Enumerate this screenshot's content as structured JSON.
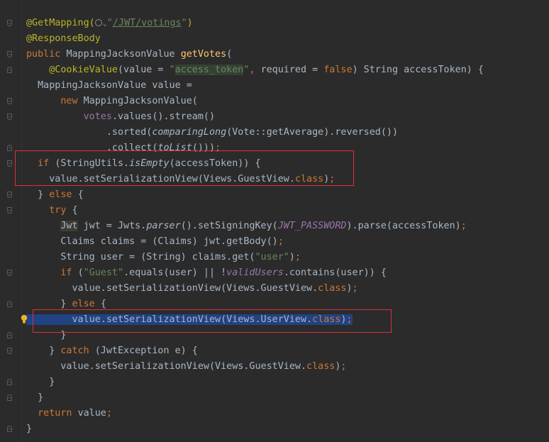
{
  "editor": {
    "lines": [
      {
        "segments": [
          {
            "t": "@GetMapping(",
            "c": "ann"
          },
          {
            "t": "globe",
            "c": "globe"
          },
          {
            "t": "⌄",
            "c": "chev"
          },
          {
            "t": "\"",
            "c": "str"
          },
          {
            "t": "/JWT/votings",
            "c": "url"
          },
          {
            "t": "\"",
            "c": "str"
          },
          {
            "t": ")",
            "c": "ann"
          }
        ]
      },
      {
        "segments": [
          {
            "t": "@ResponseBody",
            "c": "ann"
          }
        ]
      },
      {
        "segments": [
          {
            "t": "public ",
            "c": "kw"
          },
          {
            "t": "MappingJacksonValue ",
            "c": ""
          },
          {
            "t": "getVotes",
            "c": "fn"
          },
          {
            "t": "(",
            "c": ""
          }
        ]
      },
      {
        "segments": [
          {
            "t": "    ",
            "c": ""
          },
          {
            "t": "@CookieValue",
            "c": "ann"
          },
          {
            "t": "(value = ",
            "c": ""
          },
          {
            "t": "\"",
            "c": "str"
          },
          {
            "t": "access_token",
            "c": "strbg"
          },
          {
            "t": "\"",
            "c": "str"
          },
          {
            "t": ", ",
            "c": "kw"
          },
          {
            "t": "required = ",
            "c": ""
          },
          {
            "t": "false",
            "c": "kw"
          },
          {
            "t": ") String accessToken) {",
            "c": ""
          }
        ]
      },
      {
        "segments": [
          {
            "t": "  MappingJacksonValue value =",
            "c": ""
          }
        ]
      },
      {
        "segments": [
          {
            "t": "      ",
            "c": ""
          },
          {
            "t": "new ",
            "c": "kw"
          },
          {
            "t": "MappingJacksonValue(",
            "c": ""
          }
        ]
      },
      {
        "segments": [
          {
            "t": "          ",
            "c": ""
          },
          {
            "t": "votes",
            "c": "fld2"
          },
          {
            "t": ".values().stream()",
            "c": ""
          }
        ]
      },
      {
        "segments": [
          {
            "t": "              .sorted(",
            "c": ""
          },
          {
            "t": "comparingLong",
            "c": "st"
          },
          {
            "t": "(Vote::getAverage).reversed())",
            "c": ""
          }
        ]
      },
      {
        "segments": [
          {
            "t": "              .collect(",
            "c": ""
          },
          {
            "t": "toList",
            "c": "st"
          },
          {
            "t": "()))",
            "c": ""
          },
          {
            "t": ";",
            "c": "semi"
          }
        ]
      },
      {
        "segments": [
          {
            "t": "  ",
            "c": ""
          },
          {
            "t": "if ",
            "c": "kw"
          },
          {
            "t": "(StringUtils.",
            "c": ""
          },
          {
            "t": "isEmpty",
            "c": "st"
          },
          {
            "t": "(accessToken)) {",
            "c": ""
          }
        ]
      },
      {
        "segments": [
          {
            "t": "    value.setSerializationView(Views.GuestView.",
            "c": ""
          },
          {
            "t": "class",
            "c": "kw"
          },
          {
            "t": ")",
            "c": ""
          },
          {
            "t": ";",
            "c": "semi"
          }
        ]
      },
      {
        "segments": [
          {
            "t": "  } ",
            "c": ""
          },
          {
            "t": "else ",
            "c": "kw"
          },
          {
            "t": "{",
            "c": ""
          }
        ]
      },
      {
        "segments": [
          {
            "t": "    ",
            "c": ""
          },
          {
            "t": "try ",
            "c": "kw"
          },
          {
            "t": "{",
            "c": ""
          }
        ]
      },
      {
        "segments": [
          {
            "t": "      ",
            "c": ""
          },
          {
            "t": "Jwt",
            "c": "jwtbg"
          },
          {
            "t": " jwt = Jwts.",
            "c": ""
          },
          {
            "t": "parser",
            "c": "st"
          },
          {
            "t": "().setSigningKey(",
            "c": ""
          },
          {
            "t": "JWT_PASSWORD",
            "c": "fld"
          },
          {
            "t": ").parse(accessToken)",
            "c": ""
          },
          {
            "t": ";",
            "c": "semi"
          }
        ]
      },
      {
        "segments": [
          {
            "t": "      Claims claims = (Claims) jwt.getBody()",
            "c": ""
          },
          {
            "t": ";",
            "c": "semi"
          }
        ]
      },
      {
        "segments": [
          {
            "t": "      String user = (String) claims.get(",
            "c": ""
          },
          {
            "t": "\"user\"",
            "c": "str"
          },
          {
            "t": ")",
            "c": ""
          },
          {
            "t": ";",
            "c": "semi"
          }
        ]
      },
      {
        "segments": [
          {
            "t": "      ",
            "c": ""
          },
          {
            "t": "if ",
            "c": "kw"
          },
          {
            "t": "(",
            "c": ""
          },
          {
            "t": "\"Guest\"",
            "c": "str"
          },
          {
            "t": ".equals(user) || !",
            "c": ""
          },
          {
            "t": "validUsers",
            "c": "fld"
          },
          {
            "t": ".contains(user)) {",
            "c": ""
          }
        ]
      },
      {
        "segments": [
          {
            "t": "        value.setSerializationView(Views.GuestView.",
            "c": ""
          },
          {
            "t": "class",
            "c": "kw"
          },
          {
            "t": ")",
            "c": ""
          },
          {
            "t": ";",
            "c": "semi"
          }
        ]
      },
      {
        "segments": [
          {
            "t": "      } ",
            "c": ""
          },
          {
            "t": "else ",
            "c": "kw"
          },
          {
            "t": "{",
            "c": ""
          }
        ]
      },
      {
        "segments": [
          {
            "t": "        value.setSerializationView(Views.UserView.",
            "c": "sel"
          },
          {
            "t": "class",
            "c": "sel kw"
          },
          {
            "t": ")",
            "c": "sel"
          },
          {
            "t": ";",
            "c": "sel semi"
          }
        ]
      },
      {
        "segments": [
          {
            "t": "      }",
            "c": ""
          }
        ]
      },
      {
        "segments": [
          {
            "t": "    } ",
            "c": ""
          },
          {
            "t": "catch ",
            "c": "kw"
          },
          {
            "t": "(JwtException e) {",
            "c": ""
          }
        ]
      },
      {
        "segments": [
          {
            "t": "      value.setSerializationView(Views.GuestView.",
            "c": ""
          },
          {
            "t": "class",
            "c": "kw"
          },
          {
            "t": ")",
            "c": ""
          },
          {
            "t": ";",
            "c": "semi"
          }
        ]
      },
      {
        "segments": [
          {
            "t": "    }",
            "c": ""
          }
        ]
      },
      {
        "segments": [
          {
            "t": "  }",
            "c": ""
          }
        ]
      },
      {
        "segments": [
          {
            "t": "  ",
            "c": ""
          },
          {
            "t": "return ",
            "c": "kw"
          },
          {
            "t": "value",
            "c": ""
          },
          {
            "t": ";",
            "c": "semi"
          }
        ]
      },
      {
        "segments": [
          {
            "t": "}",
            "c": ""
          }
        ]
      }
    ]
  }
}
